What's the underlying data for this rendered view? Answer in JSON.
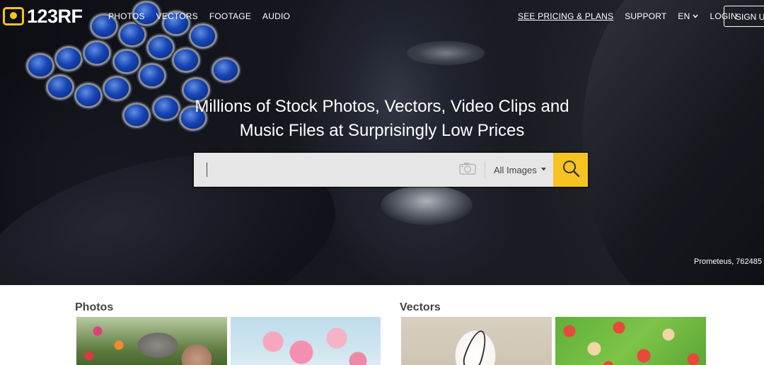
{
  "brand": {
    "logo_text": "123RF",
    "accent_color": "#f7c321"
  },
  "nav": {
    "left": [
      {
        "label": "PHOTOS"
      },
      {
        "label": "VECTORS"
      },
      {
        "label": "FOOTAGE"
      },
      {
        "label": "AUDIO"
      }
    ],
    "pricing": "SEE PRICING & PLANS",
    "support": "SUPPORT",
    "language": "EN",
    "login": "LOGIN",
    "signup": "SIGN UP"
  },
  "hero": {
    "headline_line1": "Millions of Stock Photos, Vectors, Video Clips and",
    "headline_line2": "Music Files at Surprisingly Low Prices",
    "credit": "Prometeus, 762485"
  },
  "search": {
    "value": "",
    "placeholder": "",
    "camera_icon": "camera-icon",
    "type_selected": "All Images",
    "search_icon": "search-icon"
  },
  "sections": {
    "photos_title": "Photos",
    "vectors_title": "Vectors"
  }
}
